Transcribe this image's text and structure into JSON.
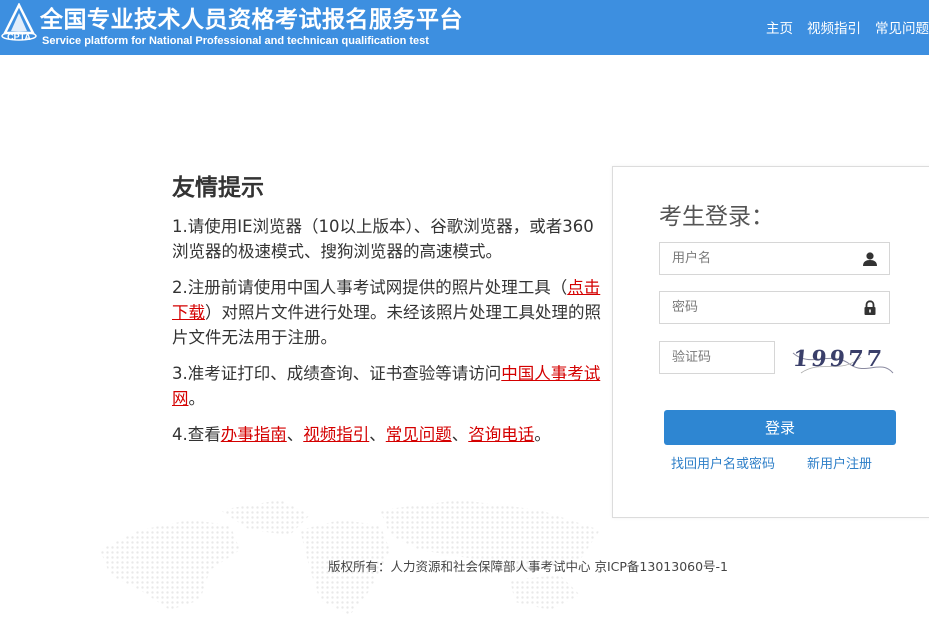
{
  "header": {
    "logo_text": "CPTA",
    "title_cn": "全国专业技术人员资格考试报名服务平台",
    "title_en": "Service platform for National Professional and technican qualification test",
    "nav": [
      "主页",
      "视频指引",
      "常见问题"
    ]
  },
  "tips": {
    "title": "友情提示",
    "tip1": "1.请使用IE浏览器（10以上版本）、谷歌浏览器，或者360浏览器的极速模式、搜狗浏览器的高速模式。",
    "tip2_a": "2.注册前请使用中国人事考试网提供的照片处理工具（",
    "tip2_link": "点击下载",
    "tip2_b": "）对照片文件进行处理。未经该照片处理工具处理的照片文件无法用于注册。",
    "tip3_a": "3.准考证打印、成绩查询、证书查验等请访问",
    "tip3_link": "中国人事考试网",
    "tip3_b": "。",
    "tip4_a": "4.查看",
    "tip4_link1": "办事指南",
    "sep1": "、",
    "tip4_link2": "视频指引",
    "sep2": "、",
    "tip4_link3": "常见问题",
    "sep3": "、",
    "tip4_link4": "咨询电话",
    "tip4_end": "。"
  },
  "login": {
    "title": "考生登录：",
    "username_placeholder": "用户名",
    "password_placeholder": "密码",
    "captcha_placeholder": "验证码",
    "captcha_text": "19977",
    "submit_label": "登录",
    "forgot_label": "找回用户名或密码",
    "register_label": "新用户注册",
    "icons": [
      "user-icon",
      "lock-icon"
    ]
  },
  "footer": {
    "copyright": "版权所有：人力资源和社会保障部人事考试中心 京ICP备13013060号-1"
  },
  "colors": {
    "header_bg": "#3d8fe0",
    "link_red": "#d40000",
    "button_blue": "#2e86d2",
    "link_blue": "#2e7fc8"
  }
}
